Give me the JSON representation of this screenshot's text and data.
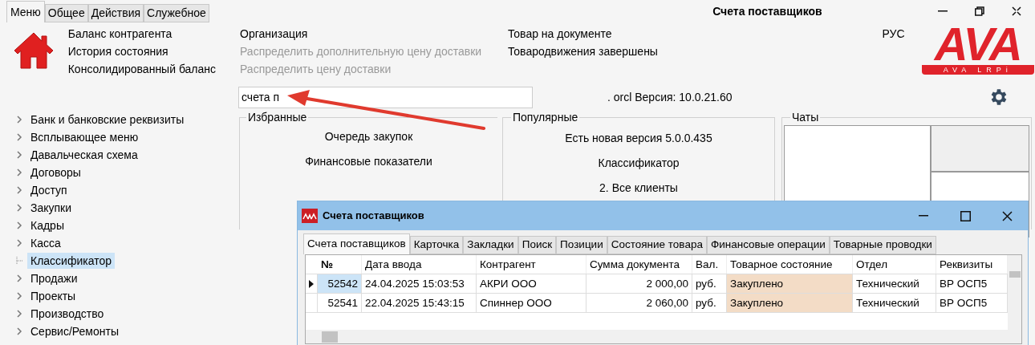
{
  "tabs": [
    {
      "label": "Меню",
      "selected": true
    },
    {
      "label": "Общее",
      "selected": false
    },
    {
      "label": "Действия",
      "selected": false
    },
    {
      "label": "Служебное",
      "selected": false
    }
  ],
  "window": {
    "title": "Счета поставщиков"
  },
  "ribbon": [
    [
      {
        "label": "Баланс контрагента",
        "disabled": false
      },
      {
        "label": "История состояния",
        "disabled": false
      },
      {
        "label": "Консолидированный баланс",
        "disabled": false
      }
    ],
    [
      {
        "label": "Организация",
        "disabled": false
      },
      {
        "label": "Распределить дополнительную цену доставки",
        "disabled": true
      },
      {
        "label": "Распределить цену доставки",
        "disabled": true
      }
    ],
    [
      {
        "label": "Товар на документе",
        "disabled": false
      },
      {
        "label": "Товародвижения завершены",
        "disabled": false
      }
    ]
  ],
  "language": "РУС",
  "logo": {
    "big": "AVA",
    "small": "AVA LRPi"
  },
  "search": {
    "value": "счета п"
  },
  "version": ". orcl Версия: 10.0.21.60",
  "tree": [
    {
      "label": "Банк и банковские реквизиты",
      "expandable": true,
      "selected": false
    },
    {
      "label": "Всплывающее меню",
      "expandable": true,
      "selected": false
    },
    {
      "label": "Давальческая схема",
      "expandable": true,
      "selected": false
    },
    {
      "label": "Договоры",
      "expandable": true,
      "selected": false
    },
    {
      "label": "Доступ",
      "expandable": true,
      "selected": false
    },
    {
      "label": "Закупки",
      "expandable": true,
      "selected": false
    },
    {
      "label": "Кадры",
      "expandable": true,
      "selected": false
    },
    {
      "label": "Касса",
      "expandable": true,
      "selected": false
    },
    {
      "label": "Классификатор",
      "expandable": false,
      "selected": true
    },
    {
      "label": "Продажи",
      "expandable": true,
      "selected": false
    },
    {
      "label": "Проекты",
      "expandable": true,
      "selected": false
    },
    {
      "label": "Производство",
      "expandable": true,
      "selected": false
    },
    {
      "label": "Сервис/Ремонты",
      "expandable": true,
      "selected": false
    }
  ],
  "favorites": {
    "title": "Избранные",
    "items": [
      "Очередь закупок",
      "Финансовые показатели"
    ]
  },
  "popular": {
    "title": "Популярные",
    "items": [
      "Есть новая версия 5.0.0.435",
      "Классификатор",
      "2. Все клиенты"
    ]
  },
  "chats": {
    "title": "Чаты"
  },
  "child_window": {
    "title": "Счета поставщиков",
    "tabs": [
      {
        "label": "Счета поставщиков",
        "selected": true
      },
      {
        "label": "Карточка",
        "selected": false
      },
      {
        "label": "Закладки",
        "selected": false
      },
      {
        "label": "Поиск",
        "selected": false
      },
      {
        "label": "Позиции",
        "selected": false
      },
      {
        "label": "Состояние товара",
        "selected": false
      },
      {
        "label": "Финансовые операции",
        "selected": false
      },
      {
        "label": "Товарные проводки",
        "selected": false
      }
    ],
    "columns": [
      "№",
      "Дата ввода",
      "Контрагент",
      "Сумма документа",
      "Вал.",
      "Товарное состояние",
      "Отдел",
      "Реквизиты"
    ],
    "rows": [
      {
        "current": true,
        "cells": [
          "52542",
          "24.04.2025 15:03:53",
          "АКРИ ООО",
          "2 000,00",
          "руб.",
          "Закуплено",
          "Технический",
          "ВР ОСП5"
        ]
      },
      {
        "current": false,
        "cells": [
          "52541",
          "22.04.2025 15:43:15",
          "Спиннер ООО",
          "2 060,00",
          "руб.",
          "Закуплено",
          "Технический",
          "ВР ОСП5"
        ]
      }
    ]
  }
}
